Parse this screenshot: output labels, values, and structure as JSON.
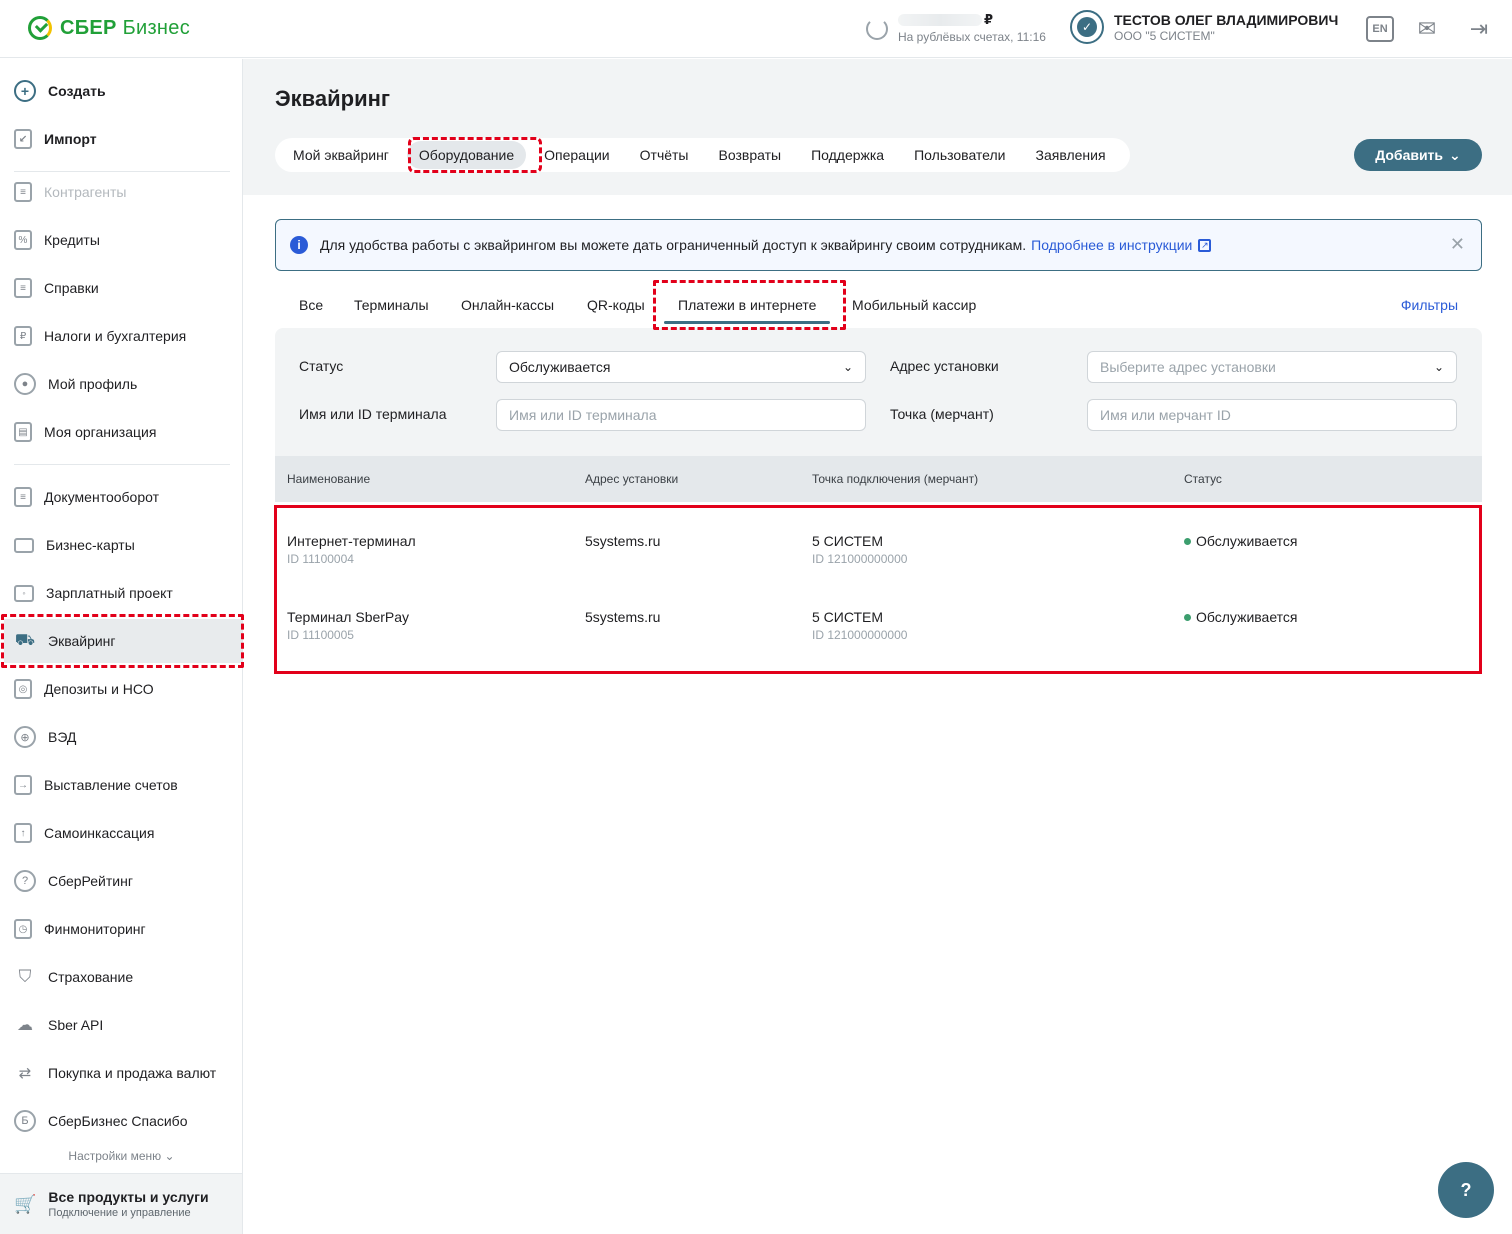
{
  "header": {
    "logo_bold": "СБЕР",
    "logo_light": "Бизнес",
    "balance_currency": "₽",
    "balance_subtitle": "На рублёвых счетах, 11:16",
    "user_name": "ТЕСТОВ ОЛЕГ ВЛАДИМИРОВИЧ",
    "user_org": "ООО \"5 СИСТЕМ\"",
    "lang_label": "EN"
  },
  "sidebar": {
    "items": [
      {
        "label": "Создать",
        "icon": "plus-circle-icon"
      },
      {
        "label": "Импорт",
        "icon": "import-icon"
      },
      {
        "label": "Контрагенты",
        "icon": "contractors-icon"
      },
      {
        "label": "Кредиты",
        "icon": "credit-icon"
      },
      {
        "label": "Справки",
        "icon": "certificate-icon"
      },
      {
        "label": "Налоги и бухгалтерия",
        "icon": "tax-icon"
      },
      {
        "label": "Мой профиль",
        "icon": "profile-icon"
      },
      {
        "label": "Моя организация",
        "icon": "organization-icon"
      },
      {
        "label": "Документооборот",
        "icon": "documents-icon"
      },
      {
        "label": "Бизнес-карты",
        "icon": "card-icon"
      },
      {
        "label": "Зарплатный проект",
        "icon": "wallet-icon"
      },
      {
        "label": "Эквайринг",
        "icon": "acquiring-cart-icon"
      },
      {
        "label": "Депозиты и НСО",
        "icon": "deposit-icon"
      },
      {
        "label": "ВЭД",
        "icon": "globe-icon"
      },
      {
        "label": "Выставление счетов",
        "icon": "invoice-icon"
      },
      {
        "label": "Самоинкассация",
        "icon": "self-collection-icon"
      },
      {
        "label": "СберРейтинг",
        "icon": "rating-icon"
      },
      {
        "label": "Финмониторинг",
        "icon": "finmonitoring-icon"
      },
      {
        "label": "Страхование",
        "icon": "shield-icon"
      },
      {
        "label": "Sber API",
        "icon": "api-cloud-icon"
      },
      {
        "label": "Покупка и продажа валют",
        "icon": "currency-exchange-icon"
      },
      {
        "label": "СберБизнес Спасибо",
        "icon": "bonus-icon"
      }
    ],
    "settings_label": "Настройки меню",
    "bottom_title": "Все продукты и услуги",
    "bottom_subtitle": "Подключение и управление"
  },
  "main": {
    "title": "Эквайринг",
    "tabs": [
      {
        "label": "Мой эквайринг"
      },
      {
        "label": "Оборудование"
      },
      {
        "label": "Операции"
      },
      {
        "label": "Отчёты"
      },
      {
        "label": "Возвраты"
      },
      {
        "label": "Поддержка"
      },
      {
        "label": "Пользователи"
      },
      {
        "label": "Заявления"
      }
    ],
    "add_button": "Добавить",
    "banner_text": "Для удобства работы с эквайрингом вы можете дать ограниченный доступ к эквайрингу своим сотрудникам.",
    "banner_link": "Подробнее в инструкции",
    "subtabs": [
      {
        "label": "Все"
      },
      {
        "label": "Терминалы"
      },
      {
        "label": "Онлайн-кассы"
      },
      {
        "label": "QR-коды"
      },
      {
        "label": "Платежи в интернете"
      },
      {
        "label": "Мобильный кассир"
      }
    ],
    "filters_link": "Фильтры",
    "filters": {
      "status_label": "Статус",
      "status_value": "Обслуживается",
      "address_label": "Адрес установки",
      "address_placeholder": "Выберите адрес установки",
      "terminal_label": "Имя или ID терминала",
      "terminal_placeholder": "Имя или ID терминала",
      "merchant_label": "Точка (мерчант)",
      "merchant_placeholder": "Имя или мерчант ID"
    },
    "table": {
      "columns": [
        "Наименование",
        "Адрес установки",
        "Точка подключения (мерчант)",
        "Статус"
      ],
      "rows": [
        {
          "name": "Интернет-терминал",
          "id": "ID 11100004",
          "address": "5systems.ru",
          "merchant": "5 СИСТЕМ",
          "merchant_id": "ID 121000000000",
          "status": "Обслуживается"
        },
        {
          "name": "Терминал SberPay",
          "id": "ID 11100005",
          "address": "5systems.ru",
          "merchant": "5 СИСТЕМ",
          "merchant_id": "ID 121000000000",
          "status": "Обслуживается"
        }
      ]
    }
  },
  "colors": {
    "brand_green": "#21a038",
    "accent": "#3c6e83",
    "link": "#2a5bd7",
    "highlight": "#e2001a",
    "status_ok": "#3c9e6e"
  }
}
